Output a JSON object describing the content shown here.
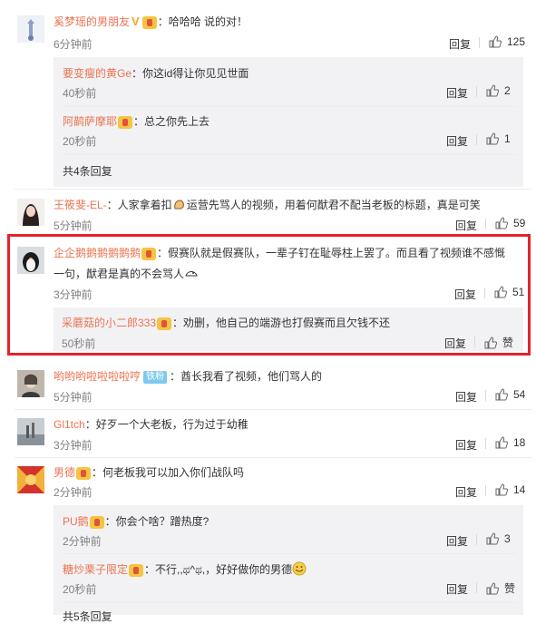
{
  "comments": [
    {
      "name": "奚梦瑶的男朋友",
      "text": "：哈哈哈 说的对！",
      "time": "6分钟前",
      "reply": "回复",
      "likes": "125",
      "replies": [
        {
          "name": "要变瘦的黄Ge",
          "text": "：你这id得让你见见世面",
          "time": "40秒前",
          "reply": "回复",
          "likes": "2"
        },
        {
          "name": "阿鹋萨摩耶",
          "text": "：总之你先上去",
          "time": "20秒前",
          "reply": "回复",
          "likes": "1"
        }
      ],
      "more": "共4条回复"
    },
    {
      "name": "王筱斐-EL-",
      "text_a": "：人家拿着扣",
      "text_b": "运营先骂人的视频，用着何猷君不配当老板的标题，真是可笑",
      "time": "5分钟前",
      "reply": "回复",
      "likes": "59"
    },
    {
      "name": "企企鹅鹅鹅鹅鹅鹅",
      "text_line1": "：假赛队就是假赛队，一辈子钉在耻辱柱上罢了。而且看了视频谁不感慨",
      "text_line2": "一句，猷君是真的不会骂人",
      "time": "3分钟前",
      "reply": "回复",
      "likes": "51",
      "sub": {
        "name": "采蘑菇的小二郎333",
        "text": "：劝删，他自己的端游也打假赛而且欠钱不还",
        "time": "50秒前",
        "reply": "回复",
        "likes": "赞"
      }
    },
    {
      "name": "哟哟哟啦啦啦啦哼",
      "fan_badge": "铁粉",
      "text": "：酋长我看了视频，他们骂人的",
      "time": "5分钟前",
      "reply": "回复",
      "likes": "54"
    },
    {
      "name": "Gl1tch",
      "text": "：好歹一个大老板，行为过于幼稚",
      "time": "3分钟前",
      "reply": "回复",
      "likes": "18"
    },
    {
      "name": "男德",
      "text": "：何老板我可以加入你们战队吗",
      "time": "2分钟前",
      "reply": "回复",
      "likes": "14",
      "replies": [
        {
          "name": "PU鹅",
          "text": "：你会个啥？蹭热度?",
          "time": "2分钟前",
          "reply": "回复",
          "likes": "3"
        },
        {
          "name": "糖炒栗子限定",
          "text": "：不行,,ಥ^ಥ,，好好做你的男德",
          "time": "20秒前",
          "reply": "回复",
          "likes": "赞"
        }
      ],
      "more": "共5条回复"
    }
  ],
  "colors": {
    "name": "#eb7350",
    "highlight": "#e3232b",
    "sub_bg": "#f2f2f5"
  }
}
